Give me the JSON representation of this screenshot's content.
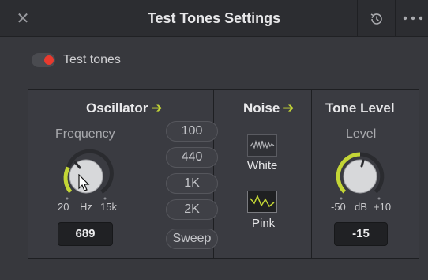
{
  "window": {
    "title": "Test Tones Settings"
  },
  "toggle": {
    "label": "Test tones",
    "on": true
  },
  "oscillator": {
    "title": "Oscillator",
    "arrow": "➔",
    "frequency_label": "Frequency",
    "scale_min": "20",
    "scale_unit": "Hz",
    "scale_max": "15k",
    "value": "689",
    "presets": [
      "100",
      "440",
      "1K",
      "2K",
      "Sweep"
    ]
  },
  "noise": {
    "title": "Noise",
    "arrow": "➔",
    "white_label": "White",
    "pink_label": "Pink",
    "selected": "Pink"
  },
  "tone_level": {
    "title": "Tone Level",
    "level_label": "Level",
    "scale_min": "-50",
    "scale_unit": "dB",
    "scale_max": "+10",
    "value": "-15"
  },
  "colors": {
    "accent": "#c4d636",
    "toggle_on": "#e83a2e"
  },
  "icons": {
    "close": "close-icon",
    "history": "history-icon",
    "more": "more-icon",
    "cursor": "cursor-icon"
  }
}
